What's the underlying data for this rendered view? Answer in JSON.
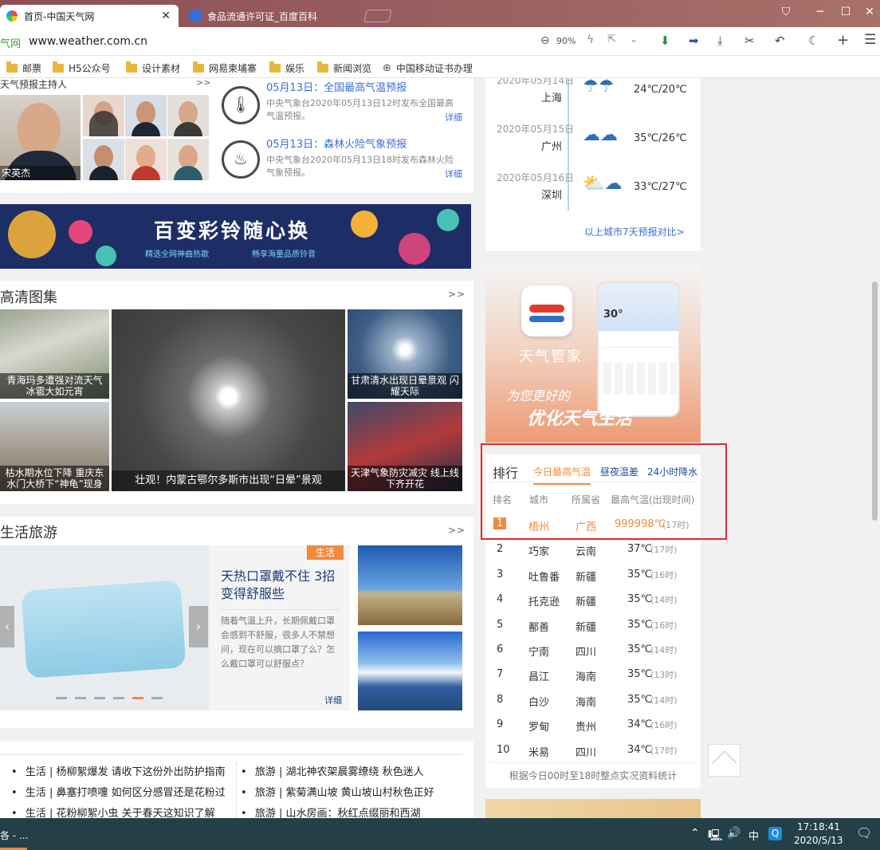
{
  "browser": {
    "tabs": [
      {
        "title": "首页-中国天气网",
        "active": true
      },
      {
        "title": "食品流通许可证_百度百科",
        "active": false
      }
    ],
    "address_prefix": "气网",
    "url": "www.weather.com.cn",
    "zoom": "90%",
    "bookmarks": [
      "邮票",
      "H5公众号",
      "设计素材",
      "网易柬埔寨",
      "娱乐",
      "新闻浏览",
      "中国移动证书办理"
    ]
  },
  "left": {
    "hosts_title": "天气预报主持人",
    "hosts_more": ">>",
    "host_main_name": "宋英杰",
    "warnings": [
      {
        "title": "05月13日：全国最高气温预报",
        "desc": "中央气象台2020年05月13日12时发布全国最高气温预报。",
        "more": "详细"
      },
      {
        "title": "05月13日：森林火险气象预报",
        "desc": "中央气象台2020年05月13日18时发布森林火险气象预报。",
        "more": "详细"
      }
    ],
    "banner": {
      "title": "百变彩铃随心换",
      "sub1": "精选全网神曲热歌",
      "sub2": "畅享海量品质铃音"
    },
    "gallery": {
      "title": "高清图集",
      "more": ">>",
      "items": [
        {
          "caption": "青海玛多遭强对流天气 冰雹大如元宵"
        },
        {
          "caption": "枯水期水位下降 重庆东水门大桥下“神龟”现身"
        },
        {
          "caption": "壮观！内蒙古鄂尔多斯市出现“日晕”景观"
        },
        {
          "caption": "甘肃清水出现日晕景观 闪耀天际"
        },
        {
          "caption": "天津气象防灾减灾 线上线下齐开花"
        }
      ]
    },
    "life": {
      "title": "生活旅游",
      "more": ">>",
      "badge": "生活",
      "headline": "天热口罩戴不住 3招变得舒服些",
      "desc": "随着气温上升，长期佩戴口罩会感到不舒服，很多人不禁想问，现在可以摘口罩了么？怎么戴口罩可以舒服点？",
      "more_link": "详细"
    },
    "links_left": [
      "生活 | 杨柳絮爆发 请收下这份外出防护指南",
      "生活 | 鼻塞打喷嚏 如何区分感冒还是花粉过",
      "生活 | 花粉柳絮小虫 关于春天这知识了解"
    ],
    "links_right": [
      "旅游 | 湖北神农架晨雾缭绕 秋色迷人",
      "旅游 | 紫菊满山坡 黄山坡山村秋色正好",
      "旅游 | 山水房画：秋红点缀丽和西湖"
    ]
  },
  "right": {
    "forecast": [
      {
        "date": "2020年05月14日",
        "city": "上海",
        "temp": "24℃/20℃"
      },
      {
        "date": "2020年05月15日",
        "city": "广州",
        "temp": "35℃/26℃"
      },
      {
        "date": "2020年05月16日",
        "city": "深圳",
        "temp": "33℃/27℃"
      }
    ],
    "forecast_link": "以上城市7天预报对比>",
    "ad": {
      "app_name": "天气管家",
      "line1": "为您更好的",
      "line2": "优化天气生活",
      "phone_temp": "30°"
    },
    "ranking": {
      "title": "排行",
      "tabs": [
        "今日最高气温",
        "昼夜温差",
        "24小时降水"
      ],
      "headers": [
        "排名",
        "城市",
        "所属省",
        "最高气温(出现时间)"
      ],
      "rows": [
        {
          "rank": "1",
          "city": "梧州",
          "province": "广西",
          "temp": "999998℃",
          "time": "(17时)"
        },
        {
          "rank": "2",
          "city": "巧家",
          "province": "云南",
          "temp": "37℃",
          "time": "(17时)"
        },
        {
          "rank": "3",
          "city": "吐鲁番",
          "province": "新疆",
          "temp": "35℃",
          "time": "(16时)"
        },
        {
          "rank": "4",
          "city": "托克逊",
          "province": "新疆",
          "temp": "35℃",
          "time": "(14时)"
        },
        {
          "rank": "5",
          "city": "鄯善",
          "province": "新疆",
          "temp": "35℃",
          "time": "(16时)"
        },
        {
          "rank": "6",
          "city": "宁南",
          "province": "四川",
          "temp": "35℃",
          "time": "(14时)"
        },
        {
          "rank": "7",
          "city": "昌江",
          "province": "海南",
          "temp": "35℃",
          "time": "(13时)"
        },
        {
          "rank": "8",
          "city": "白沙",
          "province": "海南",
          "temp": "35℃",
          "time": "(14时)"
        },
        {
          "rank": "9",
          "city": "罗甸",
          "province": "贵州",
          "temp": "34℃",
          "time": "(16时)"
        },
        {
          "rank": "10",
          "city": "米易",
          "province": "四川",
          "temp": "34℃",
          "time": "(17时)"
        }
      ],
      "footnote": "根据今日00时至18时整点实况资料统计"
    }
  },
  "taskbar": {
    "app_label": "各 - ...",
    "ime": "中",
    "time": "17:18:41",
    "date": "2020/5/13"
  },
  "colors": {
    "accent_orange": "#f08a3c",
    "link_blue": "#3a6fd8",
    "highlight_red": "#e8272b",
    "taskbar": "#243f47"
  }
}
